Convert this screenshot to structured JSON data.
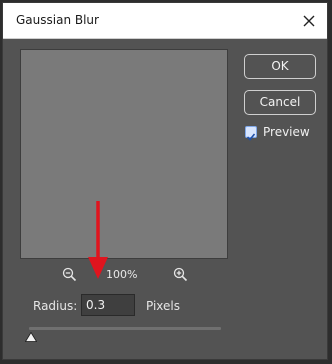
{
  "dialog": {
    "title": "Gaussian Blur",
    "close_icon": "close-icon"
  },
  "buttons": {
    "ok_label": "OK",
    "cancel_label": "Cancel"
  },
  "preview_toggle": {
    "label": "Preview",
    "checked": true
  },
  "zoom": {
    "level": "100%",
    "zoom_out_icon": "zoom-out-icon",
    "zoom_in_icon": "zoom-in-icon"
  },
  "radius": {
    "label": "Radius:",
    "value": "0.3",
    "unit": "Pixels"
  },
  "annotation": {
    "arrow_color": "#e0141e"
  },
  "colors": {
    "dialog_bg": "#535353",
    "preview_bg": "#7a7a7a",
    "titlebar_bg": "#ffffff"
  }
}
